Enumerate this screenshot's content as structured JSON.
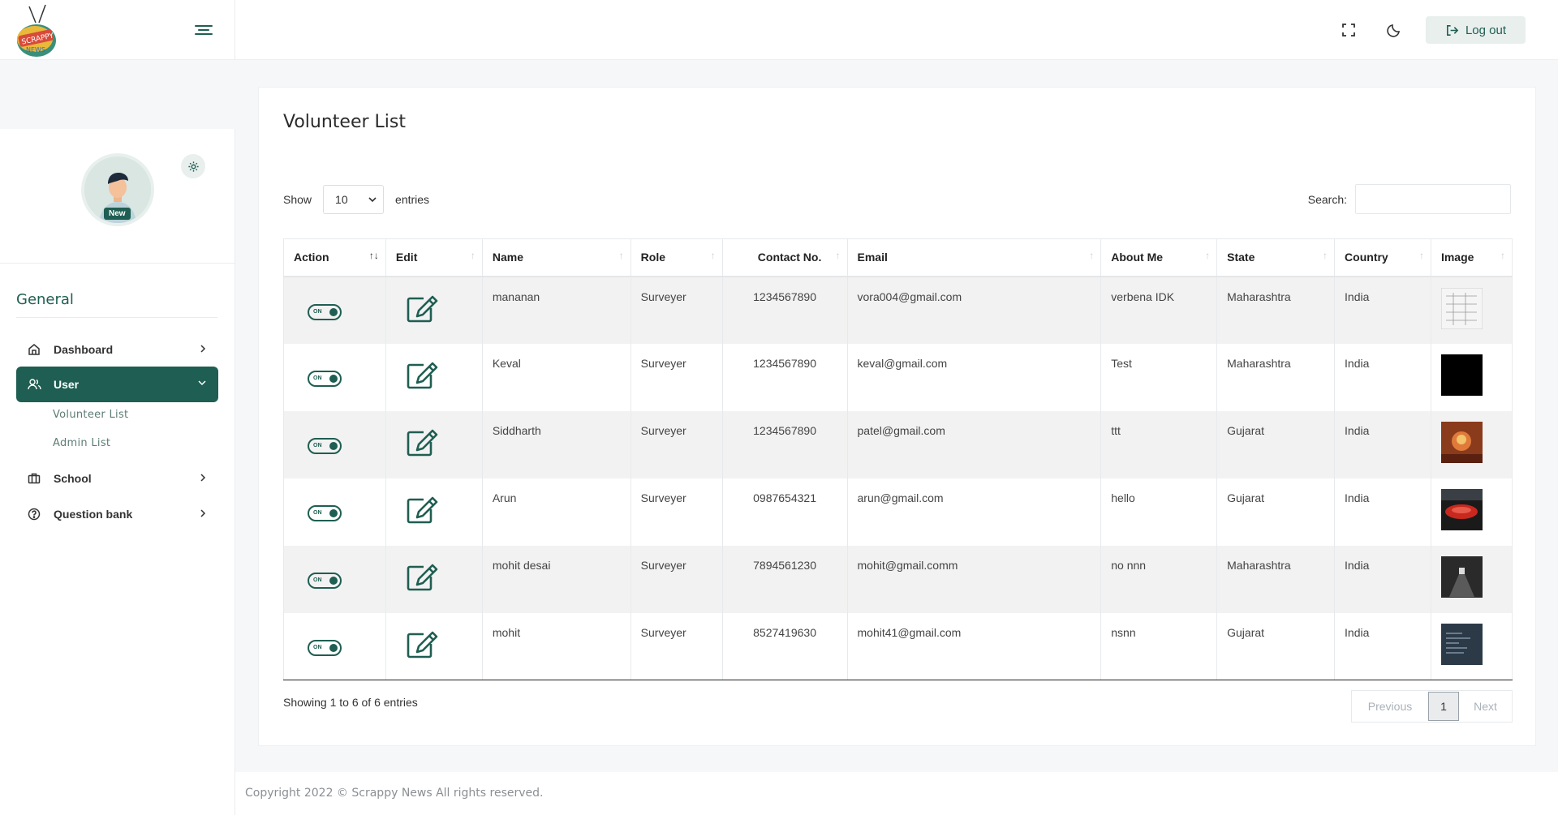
{
  "header": {
    "logo_text": "SCRAPPY NEWS",
    "logout_label": "Log out"
  },
  "sidebar": {
    "profile_badge": "New",
    "nav_heading": "General",
    "items": [
      {
        "label": "Dashboard",
        "icon": "home-icon"
      },
      {
        "label": "User",
        "icon": "users-icon",
        "active": true
      },
      {
        "label": "School",
        "icon": "briefcase-icon"
      },
      {
        "label": "Question bank",
        "icon": "question-circle-icon"
      }
    ],
    "sub_items": [
      {
        "label": "Volunteer List"
      },
      {
        "label": "Admin List"
      }
    ],
    "accent_color": "#1f5e52"
  },
  "main": {
    "title": "Volunteer List",
    "show_label": "Show",
    "entries_value": "10",
    "entries_label": "entries",
    "search_label": "Search:",
    "columns": [
      "Action",
      "Edit",
      "Name",
      "Role",
      "Contact No.",
      "Email",
      "About Me",
      "State",
      "Country",
      "Image"
    ],
    "toggle_label": "ON",
    "rows": [
      {
        "name": "mananan",
        "role": "Surveyer",
        "contact": "1234567890",
        "email": "vora004@gmail.com",
        "about": "verbena IDK",
        "state": "Maharashtra",
        "country": "India",
        "image": "sketch"
      },
      {
        "name": "Keval",
        "role": "Surveyer",
        "contact": "1234567890",
        "email": "keval@gmail.com",
        "about": "Test",
        "state": "Maharashtra",
        "country": "India",
        "image": "black"
      },
      {
        "name": "Siddharth",
        "role": "Surveyer",
        "contact": "1234567890",
        "email": "patel@gmail.com",
        "about": "ttt",
        "state": "Gujarat",
        "country": "India",
        "image": "festive"
      },
      {
        "name": "Arun",
        "role": "Surveyer",
        "contact": "0987654321",
        "email": "arun@gmail.com",
        "about": "hello",
        "state": "Gujarat",
        "country": "India",
        "image": "red-object"
      },
      {
        "name": "mohit desai",
        "role": "Surveyer",
        "contact": "7894561230",
        "email": "mohit@gmail.comm",
        "about": "no nnn",
        "state": "Maharashtra",
        "country": "India",
        "image": "hallway"
      },
      {
        "name": "mohit",
        "role": "Surveyer",
        "contact": "8527419630",
        "email": "mohit41@gmail.com",
        "about": "nsnn",
        "state": "Gujarat",
        "country": "India",
        "image": "screen"
      }
    ],
    "info": "Showing 1 to 6 of 6 entries",
    "pager": {
      "previous": "Previous",
      "page": "1",
      "next": "Next"
    }
  },
  "footer": {
    "copyright": "Copyright 2022 © Scrappy News All rights reserved."
  }
}
